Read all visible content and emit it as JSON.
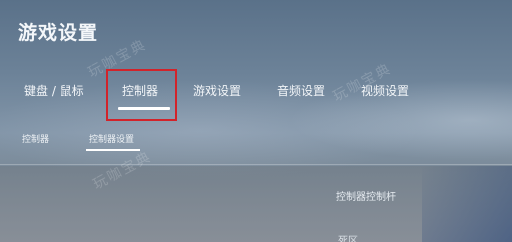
{
  "header": {
    "title": "游戏设置"
  },
  "tabs": [
    {
      "label": "键盘 / 鼠标"
    },
    {
      "label": "控制器"
    },
    {
      "label": "游戏设置"
    },
    {
      "label": "音频设置"
    },
    {
      "label": "视频设置"
    }
  ],
  "active_tab": "控制器",
  "subtabs": [
    {
      "label": "控制器"
    },
    {
      "label": "控制器设置"
    }
  ],
  "active_subtab": "控制器设置",
  "content": {
    "row1_label": "控制器控制杆",
    "row2_label": "死区"
  },
  "watermark": "玩咖宝典",
  "colors": {
    "highlight_box": "#d2232a",
    "underline": "#ffffff"
  }
}
